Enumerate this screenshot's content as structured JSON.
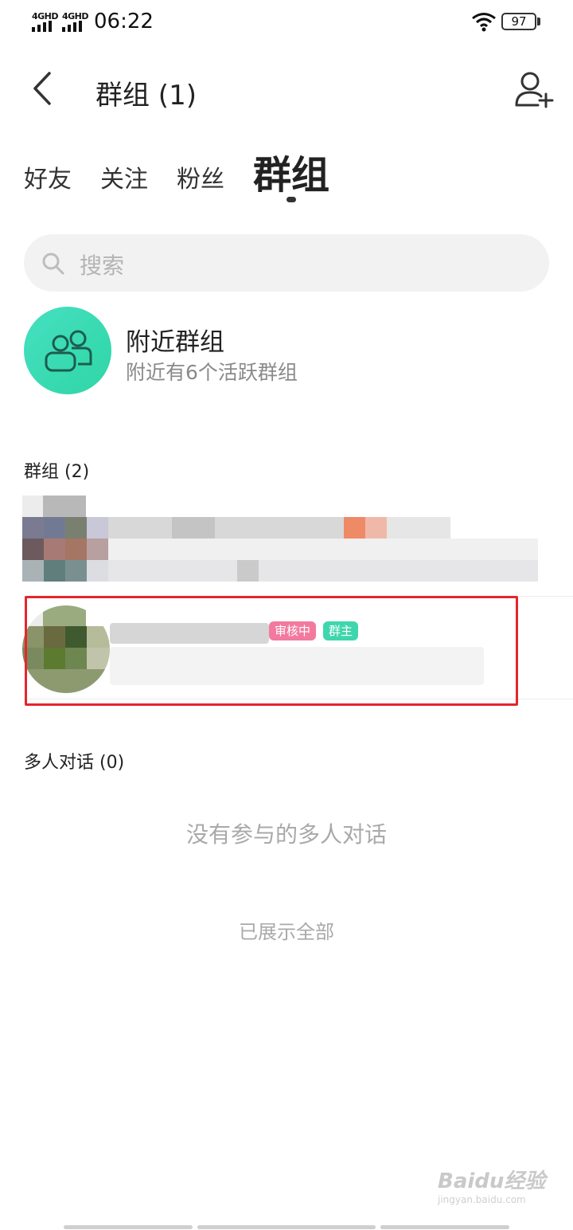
{
  "status_bar": {
    "signal1_label": "4GHD",
    "signal2_label": "4GHD",
    "time": "06:22",
    "battery": "97",
    "icons": [
      "signal-icon",
      "wifi-icon",
      "battery-icon"
    ]
  },
  "header": {
    "title": "群组 (1)",
    "back_icon": "chevron-left-icon",
    "add_icon": "add-person-icon"
  },
  "tabs": [
    {
      "label": "好友",
      "active": false
    },
    {
      "label": "关注",
      "active": false
    },
    {
      "label": "粉丝",
      "active": false
    },
    {
      "label": "群组",
      "active": true
    }
  ],
  "search": {
    "placeholder": "搜索",
    "icon": "search-icon"
  },
  "nearby": {
    "title": "附近群组",
    "subtitle": "附近有6个活跃群组",
    "icon": "group-icon",
    "accent_color": "#3ddbb3"
  },
  "groups": {
    "label": "群组 (2)",
    "items": [
      {
        "name": "",
        "badges": []
      },
      {
        "name": "",
        "badges": [
          {
            "text": "审核中",
            "color": "#f27a9e"
          },
          {
            "text": "群主",
            "color": "#3fd6ae"
          }
        ]
      }
    ]
  },
  "multi_chat": {
    "label": "多人对话 (0)",
    "empty_message": "没有参与的多人对话"
  },
  "footer": {
    "all_shown": "已展示全部"
  },
  "watermark": {
    "brand": "Baidu经验",
    "url": "jingyan.baidu.com"
  }
}
